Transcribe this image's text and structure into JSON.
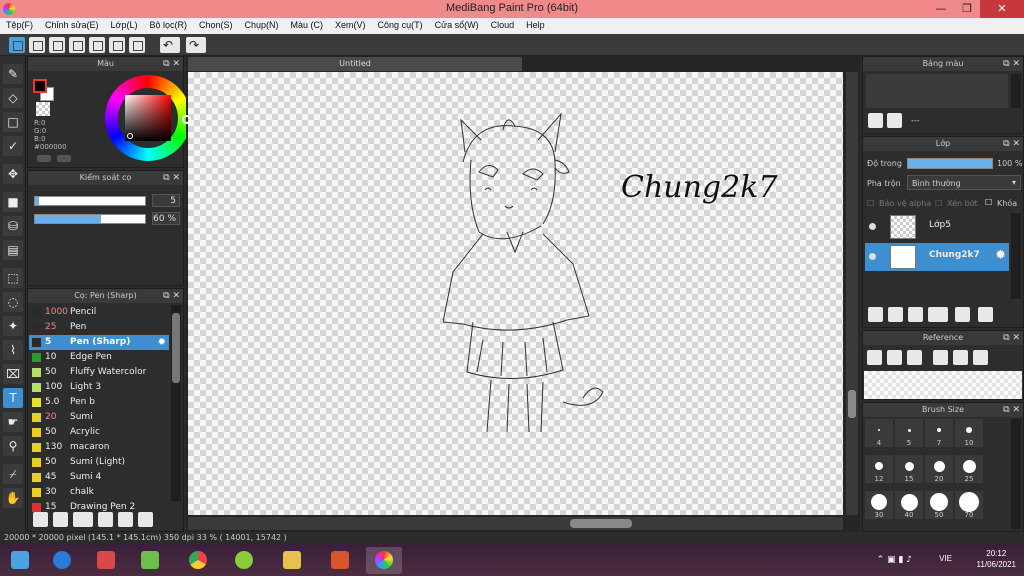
{
  "window": {
    "title": "MediBang Paint Pro (64bit)",
    "min": "—",
    "max": "❐",
    "close": "✕"
  },
  "menu": [
    "Tệp(F)",
    "Chỉnh sửa(E)",
    "Lớp(L)",
    "Bộ lọc(R)",
    "Chọn(S)",
    "Chụp(N)",
    "Màu (C)",
    "Xem(V)",
    "Công cụ(T)",
    "Cửa sổ(W)",
    "Cloud",
    "Help"
  ],
  "document": {
    "tab": "Untitled",
    "text": "Chung2k7"
  },
  "color_panel": {
    "title": "Màu",
    "r": "R:0",
    "g": "G:0",
    "b": "B:0",
    "hex": "#000000"
  },
  "brush_control": {
    "title": "Kiểm soát cọ",
    "size_value": "5",
    "opacity_value": "60 %",
    "size_fraction": 0.04,
    "opacity_fraction": 0.6
  },
  "brush_list": {
    "title": "Cọ: Pen (Sharp)",
    "items": [
      {
        "size": "1000",
        "name": "Pencil",
        "color": "#2a2a2a",
        "size_color": "#e88"
      },
      {
        "size": "25",
        "name": "Pen",
        "color": "#2a2a2a",
        "size_color": "#e88"
      },
      {
        "size": "5",
        "name": "Pen (Sharp)",
        "color": "#2a2a2a",
        "size_color": "#e88"
      },
      {
        "size": "10",
        "name": "Edge Pen",
        "color": "#2a9a2a",
        "size_color": "#eee"
      },
      {
        "size": "50",
        "name": "Fluffy Watercolor",
        "color": "#b8e068",
        "size_color": "#eee"
      },
      {
        "size": "100",
        "name": "Light 3",
        "color": "#b8e068",
        "size_color": "#eee"
      },
      {
        "size": "5.0",
        "name": "Pen b",
        "color": "#e8e030",
        "size_color": "#eee"
      },
      {
        "size": "20",
        "name": "Sumi",
        "color": "#e8d020",
        "size_color": "#e88"
      },
      {
        "size": "50",
        "name": "Acrylic",
        "color": "#e8d020",
        "size_color": "#eee"
      },
      {
        "size": "130",
        "name": "macaron",
        "color": "#e8d020",
        "size_color": "#eee"
      },
      {
        "size": "50",
        "name": "Sumi (Light)",
        "color": "#e8d020",
        "size_color": "#eee"
      },
      {
        "size": "45",
        "name": "Sumi 4",
        "color": "#e8d020",
        "size_color": "#eee"
      },
      {
        "size": "30",
        "name": "chalk",
        "color": "#e8d020",
        "size_color": "#eee"
      },
      {
        "size": "15",
        "name": "Drawing Pen 2",
        "color": "#e03030",
        "size_color": "#eee"
      }
    ],
    "selected_index": 2
  },
  "palette": {
    "title": "Bảng màu",
    "placeholder": "---"
  },
  "layers": {
    "title": "Lớp",
    "opacity_label": "Độ trong",
    "opacity_value": "100 %",
    "blend_label": "Pha trộn",
    "blend_value": "Bình thường",
    "protect_alpha": "Bảo vệ alpha",
    "clipping": "Xén bớt",
    "lock": "Khóa",
    "items": [
      {
        "name": "Lớp5",
        "selected": false
      },
      {
        "name": "Chung2k7",
        "selected": true
      }
    ]
  },
  "reference": {
    "title": "Reference"
  },
  "brush_size": {
    "title": "Brush Size",
    "sizes": [
      "4",
      "5",
      "7",
      "10",
      "12",
      "15",
      "20",
      "25",
      "30",
      "40",
      "50",
      "70"
    ]
  },
  "status": "20000 * 20000 pixel  (145.1 * 145.1cm)  350 dpi  33 %  ( 14001, 15742 )",
  "taskbar": {
    "lang": "VIE",
    "time": "20:12",
    "date": "11/06/2021"
  }
}
